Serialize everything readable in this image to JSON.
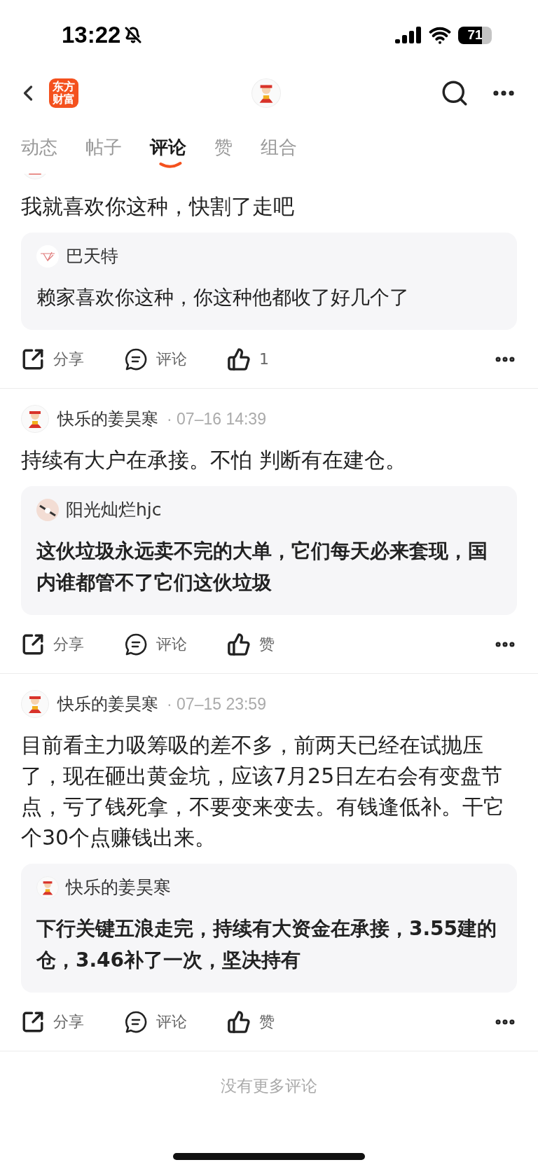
{
  "status_bar": {
    "time": "13:22",
    "battery": "71"
  },
  "nav": {
    "logo_lines": [
      "东方",
      "财富"
    ]
  },
  "tabs": [
    {
      "label": "动态",
      "selected": false
    },
    {
      "label": "帖子",
      "selected": false
    },
    {
      "label": "评论",
      "selected": true
    },
    {
      "label": "赞",
      "selected": false
    },
    {
      "label": "组合",
      "selected": false
    }
  ],
  "comments": [
    {
      "text": "我就喜欢你这种，快割了走吧",
      "quote": {
        "author": "巴天特",
        "text": "赖家喜欢你这种，你这种他都收了好几个了",
        "emphasized": false
      },
      "actions": {
        "share": "分享",
        "comment": "评论",
        "like": "1"
      }
    },
    {
      "author": "快乐的姜昊寒",
      "time": "· 07–16 14:39",
      "text": "持续有大户在承接。不怕 判断有在建仓。",
      "quote": {
        "author": "阳光灿烂hjc",
        "text": "这伙垃圾永远卖不完的大单，它们每天必来套现，国内谁都管不了它们这伙垃圾",
        "emphasized": true
      },
      "actions": {
        "share": "分享",
        "comment": "评论",
        "like": "赞"
      }
    },
    {
      "author": "快乐的姜昊寒",
      "time": "· 07–15 23:59",
      "text": "目前看主力吸筹吸的差不多，前两天已经在试抛压了，现在砸出黄金坑，应该7月25日左右会有变盘节点，亏了钱死拿，不要变来变去。有钱逢低补。干它个30个点赚钱出来。",
      "quote": {
        "author": "快乐的姜昊寒",
        "text": "下行关键五浪走完，持续有大资金在承接，3.55建的仓，3.46补了一次，坚决持有",
        "emphasized": true
      },
      "actions": {
        "share": "分享",
        "comment": "评论",
        "like": "赞"
      }
    }
  ],
  "footer": "没有更多评论"
}
